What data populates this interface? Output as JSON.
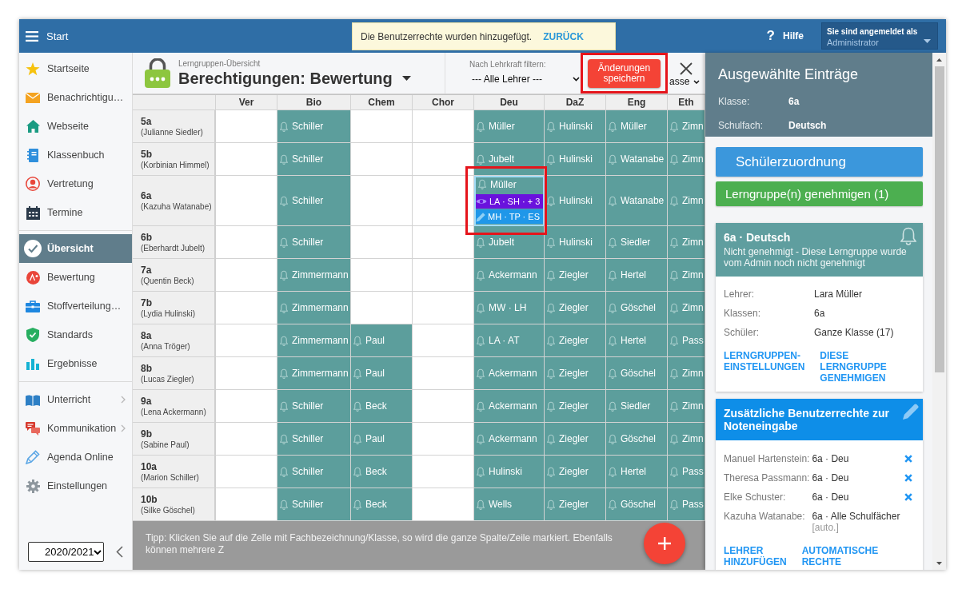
{
  "top_bar": {
    "menu_label": "Start",
    "toast": {
      "message": "Die Benutzerrechte wurden hinzugefügt.",
      "action": "ZURÜCK"
    },
    "help": {
      "symbol": "?",
      "label": "Hilfe"
    },
    "account": {
      "caption": "Sie sind angemeldet als",
      "user": "Administrator"
    }
  },
  "sidebar": {
    "groups": [
      {
        "items": [
          {
            "label": "Startseite",
            "selected": false,
            "submenu": false
          },
          {
            "label": "Benachrichtigu…",
            "selected": false,
            "submenu": false
          },
          {
            "label": "Webseite",
            "selected": false,
            "submenu": false
          },
          {
            "label": "Klassenbuch",
            "selected": false,
            "submenu": false
          },
          {
            "label": "Vertretung",
            "selected": false,
            "submenu": false
          },
          {
            "label": "Termine",
            "selected": false,
            "submenu": false
          }
        ]
      },
      {
        "items": [
          {
            "label": "Übersicht",
            "selected": true,
            "submenu": false
          },
          {
            "label": "Bewertung",
            "selected": false,
            "submenu": false
          },
          {
            "label": "Stoffverteilung…",
            "selected": false,
            "submenu": false
          },
          {
            "label": "Standards",
            "selected": false,
            "submenu": false
          },
          {
            "label": "Ergebnisse",
            "selected": false,
            "submenu": false
          }
        ]
      },
      {
        "items": [
          {
            "label": "Unterricht",
            "selected": false,
            "submenu": true
          },
          {
            "label": "Kommunikation",
            "selected": false,
            "submenu": true
          },
          {
            "label": "Agenda Online",
            "selected": false,
            "submenu": false
          },
          {
            "label": "Einstellungen",
            "selected": false,
            "submenu": false
          }
        ]
      }
    ],
    "year_select": {
      "value": "2020/2021"
    }
  },
  "header": {
    "subtitle": "Lerngruppen-Übersicht",
    "title": "Berechtigungen: Bewertung",
    "teacher_filter": {
      "label": "Nach Lehrkraft filtern:",
      "value": "--- Alle Lehrer ---"
    },
    "save_button": {
      "label": "Änderungen speichern",
      "highlighted": true
    },
    "class_filter": {
      "value": "asse"
    }
  },
  "grid": {
    "columns": [
      "Ver",
      "Bio",
      "Chem",
      "Chor",
      "Deu",
      "DaZ",
      "Eng",
      "Eth"
    ],
    "rows": [
      {
        "class": "5a",
        "teacher": "(Julianne Siedler)",
        "cells": [
          null,
          {
            "text": "Schiller",
            "selected": false
          },
          null,
          null,
          {
            "text": "Müller",
            "selected": false
          },
          {
            "text": "Hulinski",
            "selected": false
          },
          {
            "text": "Müller",
            "selected": false
          },
          {
            "text": "Zimn",
            "selected": false
          }
        ]
      },
      {
        "class": "5b",
        "teacher": "(Korbinian Himmel)",
        "cells": [
          null,
          {
            "text": "Schiller",
            "selected": false
          },
          null,
          null,
          {
            "text": "Jubelt",
            "selected": false
          },
          {
            "text": "Hulinski",
            "selected": false
          },
          {
            "text": "Watanabe",
            "selected": false
          },
          {
            "text": "Zimn",
            "selected": false
          }
        ]
      },
      {
        "class": "6a",
        "teacher": "(Kazuha Watanabe)",
        "cells": [
          null,
          {
            "text": "Schiller",
            "selected": false
          },
          null,
          null,
          {
            "text": "Müller",
            "selected": true,
            "highlighted": true,
            "viewers": "LA · SH · + 3",
            "editors": "MH · TP · ES"
          },
          {
            "text": "Hulinski",
            "selected": false
          },
          {
            "text": "Watanabe",
            "selected": false
          },
          {
            "text": "Zimn",
            "selected": false
          }
        ]
      },
      {
        "class": "6b",
        "teacher": "(Eberhardt Jubelt)",
        "cells": [
          null,
          {
            "text": "Schiller",
            "selected": false
          },
          null,
          null,
          {
            "text": "Jubelt",
            "selected": false
          },
          {
            "text": "Hulinski",
            "selected": false
          },
          {
            "text": "Siedler",
            "selected": false
          },
          {
            "text": "Zimn",
            "selected": false
          }
        ]
      },
      {
        "class": "7a",
        "teacher": "(Quentin Beck)",
        "cells": [
          null,
          {
            "text": "Zimmermann",
            "selected": false
          },
          null,
          null,
          {
            "text": "Ackermann",
            "selected": false
          },
          {
            "text": "Ziegler",
            "selected": false
          },
          {
            "text": "Hertel",
            "selected": false
          },
          {
            "text": "Zimn",
            "selected": false
          }
        ]
      },
      {
        "class": "7b",
        "teacher": "(Lydia Hulinski)",
        "cells": [
          null,
          {
            "text": "Zimmermann",
            "selected": false
          },
          null,
          null,
          {
            "text": "MW · LH",
            "selected": false
          },
          {
            "text": "Ziegler",
            "selected": false
          },
          {
            "text": "Göschel",
            "selected": false
          },
          {
            "text": "Zimn",
            "selected": false
          }
        ]
      },
      {
        "class": "8a",
        "teacher": "(Anna Tröger)",
        "cells": [
          null,
          {
            "text": "Zimmermann",
            "selected": false
          },
          {
            "text": "Paul",
            "selected": false
          },
          null,
          {
            "text": "LA · AT",
            "selected": false
          },
          {
            "text": "Ziegler",
            "selected": false
          },
          {
            "text": "Hertel",
            "selected": false
          },
          {
            "text": "Pass",
            "selected": false
          }
        ]
      },
      {
        "class": "8b",
        "teacher": "(Lucas Ziegler)",
        "cells": [
          null,
          {
            "text": "Zimmermann",
            "selected": false
          },
          {
            "text": "Paul",
            "selected": false
          },
          null,
          {
            "text": "Ackermann",
            "selected": false
          },
          {
            "text": "Ziegler",
            "selected": false
          },
          {
            "text": "Göschel",
            "selected": false
          },
          {
            "text": "Zimn",
            "selected": false
          }
        ]
      },
      {
        "class": "9a",
        "teacher": "(Lena Ackermann)",
        "cells": [
          null,
          {
            "text": "Schiller",
            "selected": false
          },
          {
            "text": "Beck",
            "selected": false
          },
          null,
          {
            "text": "Ackermann",
            "selected": false
          },
          {
            "text": "Ziegler",
            "selected": false
          },
          {
            "text": "Siedler",
            "selected": false
          },
          {
            "text": "Zimn",
            "selected": false
          }
        ]
      },
      {
        "class": "9b",
        "teacher": "(Sabine Paul)",
        "cells": [
          null,
          {
            "text": "Schiller",
            "selected": false
          },
          {
            "text": "Paul",
            "selected": false
          },
          null,
          {
            "text": "Ackermann",
            "selected": false
          },
          {
            "text": "Ziegler",
            "selected": false
          },
          {
            "text": "Göschel",
            "selected": false
          },
          {
            "text": "Zimn",
            "selected": false
          }
        ]
      },
      {
        "class": "10a",
        "teacher": "(Marion Schiller)",
        "cells": [
          null,
          {
            "text": "Schiller",
            "selected": false
          },
          {
            "text": "Beck",
            "selected": false
          },
          null,
          {
            "text": "Hulinski",
            "selected": false
          },
          {
            "text": "Ziegler",
            "selected": false
          },
          {
            "text": "Hertel",
            "selected": false
          },
          {
            "text": "Pass",
            "selected": false
          }
        ]
      },
      {
        "class": "10b",
        "teacher": "(Silke Göschel)",
        "cells": [
          null,
          {
            "text": "Schiller",
            "selected": false
          },
          {
            "text": "Beck",
            "selected": false
          },
          null,
          {
            "text": "Wells",
            "selected": false
          },
          {
            "text": "Ziegler",
            "selected": false
          },
          {
            "text": "Göschel",
            "selected": false
          },
          {
            "text": "Pass",
            "selected": false
          }
        ]
      }
    ]
  },
  "tip": "Tipp: Klicken Sie auf die Zelle mit Fachbezeichnung/Klasse, so wird die ganze Spalte/Zeile markiert. Ebenfalls können mehrere Z",
  "details_panel": {
    "title": "Ausgewählte Einträge",
    "fields": [
      {
        "label": "Klasse:",
        "value": "6a"
      },
      {
        "label": "Schulfach:",
        "value": "Deutsch"
      }
    ],
    "assign_button": "Schülerzuordnung",
    "approve_button": "Lerngruppe(n) genehmigen (1)",
    "group_card": {
      "title": "6a · Deutsch",
      "status": "Nicht genehmigt - Diese Lerngruppe wurde vom Admin noch nicht genehmigt",
      "fields": [
        {
          "label": "Lehrer:",
          "value": "Lara Müller"
        },
        {
          "label": "Klassen:",
          "value": "6a"
        },
        {
          "label": "Schüler:",
          "value": "Ganze Klasse (17)"
        }
      ],
      "links": [
        "LERNGRUPPEN-EINSTELLUNGEN",
        "DIESE LERNGRUPPE GENEHMIGEN"
      ]
    },
    "rights_card": {
      "title": "Zusätzliche Benutzerrechte zur Noteneingabe",
      "entries": [
        {
          "teacher": "Manuel Hartenstein:",
          "scope": "6a · Deu",
          "removable": true
        },
        {
          "teacher": "Theresa Passmann:",
          "scope": "6a · Deu",
          "removable": true
        },
        {
          "teacher": "Elke Schuster:",
          "scope": "6a · Deu",
          "removable": true
        },
        {
          "teacher": "Kazuha Watanabe:",
          "scope": "6a · Alle Schulfächer",
          "note": "[auto.]",
          "removable": false
        }
      ],
      "links": [
        "LEHRER HINZUFÜGEN",
        "AUTOMATISCHE RECHTE"
      ]
    }
  }
}
